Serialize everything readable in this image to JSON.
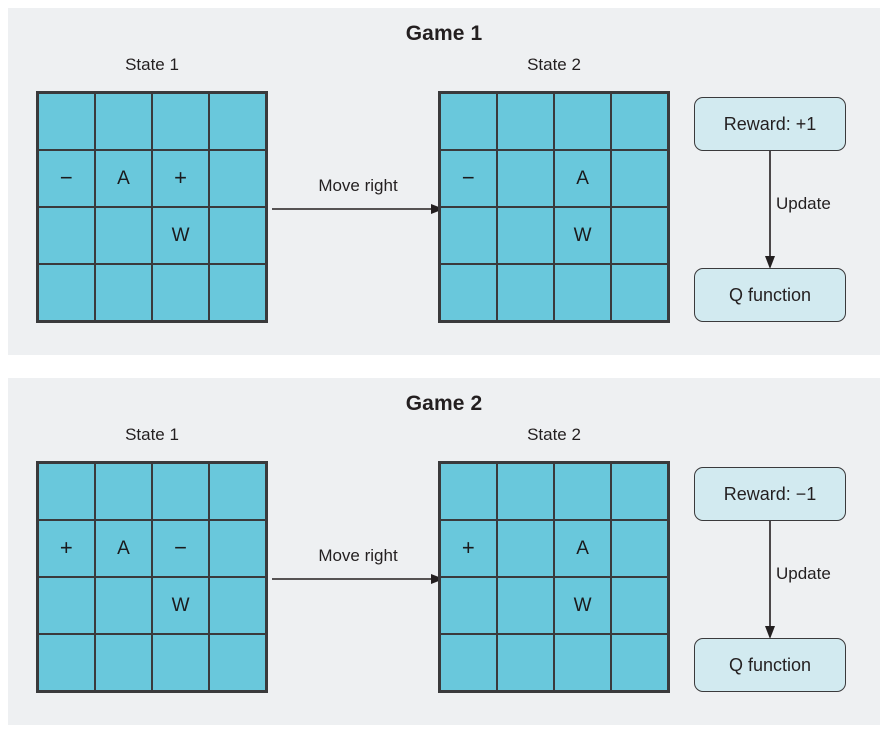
{
  "figure": {
    "background": "#ffffff",
    "panel_background": "#eef0f2",
    "cell_color": "#69c8dc",
    "box_color": "#d2eaf0",
    "line_color": "#3a3a3c",
    "text_color": "#231f20"
  },
  "games": [
    {
      "title": "Game 1",
      "state1_label": "State 1",
      "state2_label": "State 2",
      "action_label": "Move right",
      "reward_label": "Reward: +1",
      "update_label": "Update",
      "qfunction_label": "Q function",
      "state1_grid": [
        [
          "",
          "",
          "",
          ""
        ],
        [
          "−",
          "A",
          "+",
          ""
        ],
        [
          "",
          "",
          "W",
          ""
        ],
        [
          "",
          "",
          "",
          ""
        ]
      ],
      "state2_grid": [
        [
          "",
          "",
          "",
          ""
        ],
        [
          "−",
          "",
          "A",
          ""
        ],
        [
          "",
          "",
          "W",
          ""
        ],
        [
          "",
          "",
          "",
          ""
        ]
      ]
    },
    {
      "title": "Game 2",
      "state1_label": "State 1",
      "state2_label": "State 2",
      "action_label": "Move right",
      "reward_label": "Reward: −1",
      "update_label": "Update",
      "qfunction_label": "Q function",
      "state1_grid": [
        [
          "",
          "",
          "",
          ""
        ],
        [
          "+",
          "A",
          "−",
          ""
        ],
        [
          "",
          "",
          "W",
          ""
        ],
        [
          "",
          "",
          "",
          ""
        ]
      ],
      "state2_grid": [
        [
          "",
          "",
          "",
          ""
        ],
        [
          "+",
          "",
          "A",
          ""
        ],
        [
          "",
          "",
          "W",
          ""
        ],
        [
          "",
          "",
          "",
          ""
        ]
      ]
    }
  ],
  "legend_symbols": {
    "agent": "A",
    "wall": "W",
    "positive": "+",
    "negative": "−"
  }
}
